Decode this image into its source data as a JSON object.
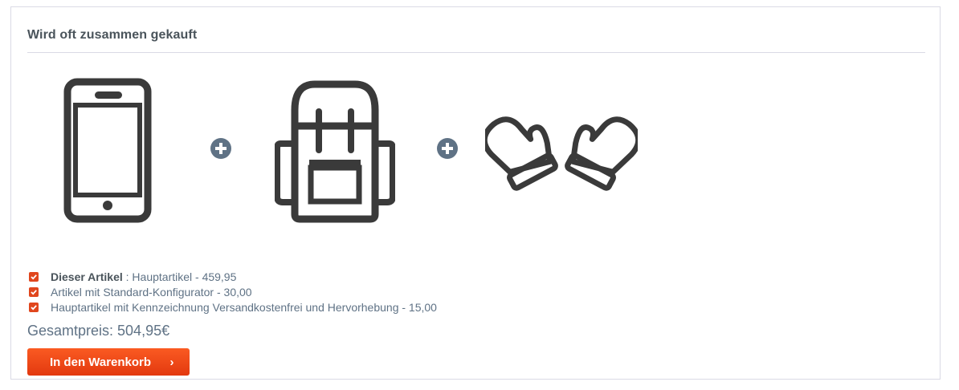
{
  "panel": {
    "title": "Wird oft zusammen gekauft"
  },
  "products": [
    {
      "icon": "smartphone-icon"
    },
    {
      "icon": "backpack-icon"
    },
    {
      "icon": "mittens-icon"
    }
  ],
  "plus_icon": "plus-circle-icon",
  "items": [
    {
      "checked": true,
      "bold_label": "Dieser Artikel",
      "text": " : Hauptartikel - 459,95"
    },
    {
      "checked": true,
      "text": "Artikel mit Standard-Konfigurator - 30,00"
    },
    {
      "checked": true,
      "text": "Hauptartikel mit Kennzeichnung Versandkostenfrei und Hervorhebung - 15,00"
    }
  ],
  "total": "Gesamtpreis: 504,95€",
  "cart_button": {
    "label": "In den Warenkorb",
    "chevron": "›"
  },
  "colors": {
    "accent": "#e0461d",
    "icon": "#3a3a3a",
    "plus": "#5f7285",
    "text": "#5f7285"
  }
}
